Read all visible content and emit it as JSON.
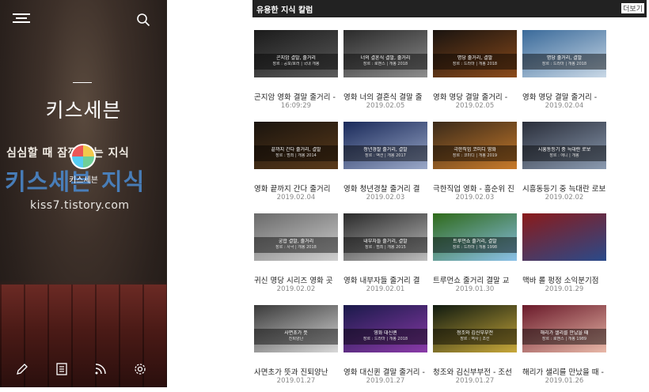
{
  "sidebar": {
    "blog_title": "키스세븐",
    "tagline": "심심할 때 잠깐 읽는 지식",
    "brand": "키스세븐 지식",
    "url": "kiss7.tistory.com",
    "avatar_name": "키스세븐",
    "icons": [
      "menu-icon",
      "search-icon",
      "write-icon",
      "guestbook-icon",
      "rss-icon",
      "settings-icon"
    ]
  },
  "section": {
    "title": "유용한 지식 칼럼",
    "more": "더보기"
  },
  "posts": [
    {
      "title": "곤지암 영화 결말 줄거리 -",
      "date": "16:09:29",
      "cap1": "곤지암 결말, 줄거리",
      "cap2": "장르 : 공포/호러 | 국내 개봉",
      "colors": [
        "#1b1b1b",
        "#5a5a5a"
      ]
    },
    {
      "title": "영화 너의 결혼식 결말 줄",
      "date": "2019.02.05",
      "cap1": "너의 결혼식 결말, 줄거리",
      "cap2": "장르 : 로맨스 | 개봉 2018",
      "colors": [
        "#2a2a2a",
        "#8c8c8c"
      ]
    },
    {
      "title": "영화 명당 결말 줄거리 -",
      "date": "2019.02.05",
      "cap1": "명당 줄거리, 결말",
      "cap2": "장르 : 드라마 | 개봉 2018",
      "colors": [
        "#1a1410",
        "#8a4a1a"
      ]
    },
    {
      "title": "영화 명당 결말 줄거리 -",
      "date": "2019.02.04",
      "cap1": "명당 줄거리, 결말",
      "cap2": "장르 : 드라마 | 개봉 2018",
      "colors": [
        "#3a6a9a",
        "#c9d8e6"
      ]
    },
    {
      "title": "영화 끝까지 간다 줄거리",
      "date": "2019.02.04",
      "cap1": "끝까지 간다 줄거리, 결말",
      "cap2": "장르 : 범죄 | 개봉 2014",
      "colors": [
        "#1a140e",
        "#5a3a1a"
      ]
    },
    {
      "title": "영화 청년경찰 줄거리 결",
      "date": "2019.02.03",
      "cap1": "청년경찰 줄거리, 결말",
      "cap2": "장르 : 액션 | 개봉 2017",
      "colors": [
        "#1a2a5a",
        "#9aa8c8"
      ]
    },
    {
      "title": "극한직업 영화 - 흥순위 진",
      "date": "2019.02.03",
      "cap1": "극한직업 코미디 영화",
      "cap2": "장르 : 코미디 | 개봉 2019",
      "colors": [
        "#3a2a1a",
        "#c87a2a"
      ]
    },
    {
      "title": "시흥동등기 중 늑대란 로보",
      "date": "2019.02.02",
      "cap1": "시흥동등기 중 늑대란 로보",
      "cap2": "장르 : 애니 | 개봉",
      "colors": [
        "#2a2e3a",
        "#8a9ab0"
      ]
    },
    {
      "title": "귀신 명당 시리즈 영화 곳",
      "date": "2019.02.02",
      "cap1": "궁합 결말, 줄거리",
      "cap2": "장르 : 사극 | 개봉 2018",
      "colors": [
        "#6a6a6a",
        "#cfcfcf"
      ]
    },
    {
      "title": "영화 내부자들 줄거리 결",
      "date": "2019.02.01",
      "cap1": "내부자들 줄거리, 결말",
      "cap2": "장르 : 범죄 | 개봉 2015",
      "colors": [
        "#2a2a2a",
        "#bdbdbd"
      ]
    },
    {
      "title": "트루먼쇼 줄거리 결말 교",
      "date": "2019.01.30",
      "cap1": "트루먼쇼 줄거리, 결말",
      "cap2": "장르 : 드라마 | 개봉 1998",
      "colors": [
        "#2f6a1a",
        "#8ac0e8"
      ]
    },
    {
      "title": "맥바 롤 펑정 소익분기점",
      "date": "2019.01.29",
      "cap1": "",
      "cap2": "",
      "colors": [
        "#8a1a1a",
        "#2a4a8a"
      ]
    },
    {
      "title": "사면초가 뜻과 진퇴양난",
      "date": "2019.01.27",
      "cap1": "사면초가 뜻",
      "cap2": "진퇴양난",
      "colors": [
        "#3a3a3a",
        "#d8d8d8"
      ]
    },
    {
      "title": "영화 대신퀸 결말 줄거리 -",
      "date": "2019.01.27",
      "cap1": "영화 대신퀸",
      "cap2": "장르 : 드라마 | 개봉 2018",
      "colors": [
        "#1a1a4a",
        "#8a3aa8"
      ]
    },
    {
      "title": "청조와 김신부부전 - 조선",
      "date": "2019.01.27",
      "cap1": "청조와 김신부부전",
      "cap2": "장르 : 역사 | 조선",
      "colors": [
        "#101a10",
        "#c8a83a"
      ]
    },
    {
      "title": "해리가 샐리를 만났을 때 -",
      "date": "2019.01.26",
      "cap1": "해리가 샐리를 만났을 때",
      "cap2": "장르 : 로맨스 | 개봉 1989",
      "colors": [
        "#6a1a2a",
        "#e8b8a8"
      ]
    }
  ]
}
